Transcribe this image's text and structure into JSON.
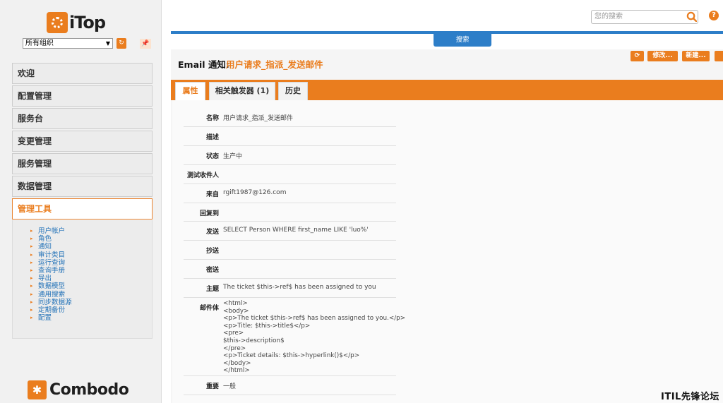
{
  "brand": {
    "name": "iTop",
    "footer_brand": "Combodo"
  },
  "org_selector": {
    "value": "所有组织"
  },
  "menu": {
    "items": [
      {
        "label": "欢迎"
      },
      {
        "label": "配置管理"
      },
      {
        "label": "服务台"
      },
      {
        "label": "变更管理"
      },
      {
        "label": "服务管理"
      },
      {
        "label": "数据管理"
      },
      {
        "label": "管理工具"
      }
    ],
    "submenu": [
      "用户帐户",
      "角色",
      "通知",
      "审计类目",
      "运行查询",
      "查询手册",
      "导出",
      "数据模型",
      "通用搜索",
      "同步数据源",
      "定期备份",
      "配置"
    ]
  },
  "search": {
    "placeholder": "您的搜索",
    "drawer_label": "搜索"
  },
  "header": {
    "object_class": "Email 通知:",
    "object_name": "用户请求_指派_发送邮件"
  },
  "actions": {
    "modify": "修改...",
    "new": "新建..."
  },
  "tabs": [
    {
      "label": "属性"
    },
    {
      "label": "相关触发器 (1)"
    },
    {
      "label": "历史"
    }
  ],
  "properties": [
    {
      "label": "名称",
      "value": "用户请求_指派_发送邮件"
    },
    {
      "label": "描述",
      "value": ""
    },
    {
      "label": "状态",
      "value": "生产中"
    },
    {
      "label": "测试收件人",
      "value": ""
    },
    {
      "label": "来自",
      "value": "rgift1987@126.com"
    },
    {
      "label": "回复到",
      "value": ""
    },
    {
      "label": "发送",
      "value": "SELECT Person WHERE first_name LIKE 'luo%'"
    },
    {
      "label": "抄送",
      "value": ""
    },
    {
      "label": "密送",
      "value": ""
    },
    {
      "label": "主题",
      "value": "The ticket $this->ref$ has been assigned to you"
    },
    {
      "label": "邮件体",
      "value": "<html>\n<body>\n<p>The ticket $this->ref$ has been assigned to you.</p>\n<p>Title: $this->title$</p>\n<pre>\n$this->description$\n</pre>\n<p>Ticket details: $this->hyperlink()$</p>\n</body>\n</html>"
    },
    {
      "label": "重要",
      "value": "一般"
    }
  ],
  "watermark": "ITIL先锋论坛",
  "colors": {
    "accent": "#ea7d1e",
    "drawer": "#2d7ec8",
    "link": "#2272b8"
  }
}
